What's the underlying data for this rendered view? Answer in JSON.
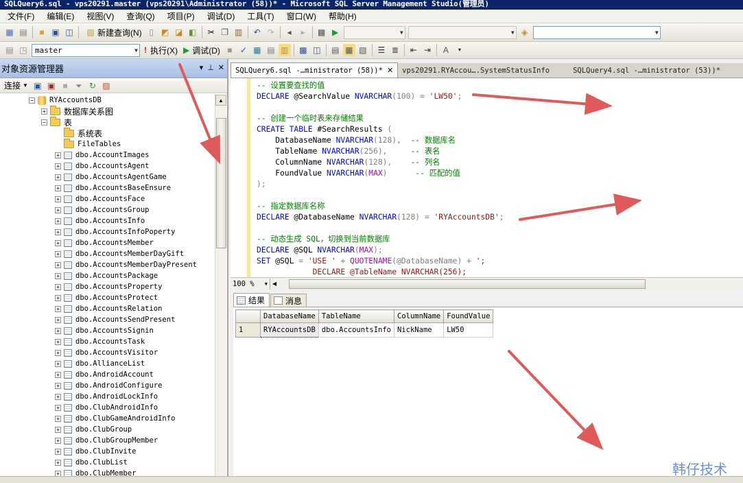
{
  "window": {
    "title": "SQLQuery6.sql - vps20291.master (vps20291\\Administrator (58))* - Microsoft SQL Server Management Studio(管理员)"
  },
  "menu": [
    "文件(F)",
    "编辑(E)",
    "视图(V)",
    "查询(Q)",
    "项目(P)",
    "调试(D)",
    "工具(T)",
    "窗口(W)",
    "帮助(H)"
  ],
  "toolbar": {
    "new_query": "新建查询(N)",
    "database": "master",
    "execute": "执行(X)",
    "debug": "调试(D)"
  },
  "object_explorer": {
    "title": "对象资源管理器",
    "connect": "连接",
    "tree": [
      {
        "label": "RYAccountsDB",
        "kind": "db",
        "expander": "−"
      },
      {
        "label": "数据库关系图",
        "kind": "folder",
        "expander": "+"
      },
      {
        "label": "表",
        "kind": "folder",
        "expander": "−"
      },
      {
        "label": "系统表",
        "kind": "folder",
        "expander": ""
      },
      {
        "label": "FileTables",
        "kind": "folder",
        "expander": ""
      },
      {
        "label": "dbo.AccountImages",
        "kind": "table",
        "expander": "+"
      },
      {
        "label": "dbo.AccountsAgent",
        "kind": "table",
        "expander": "+"
      },
      {
        "label": "dbo.AccountsAgentGame",
        "kind": "table",
        "expander": "+"
      },
      {
        "label": "dbo.AccountsBaseEnsure",
        "kind": "table",
        "expander": "+"
      },
      {
        "label": "dbo.AccountsFace",
        "kind": "table",
        "expander": "+"
      },
      {
        "label": "dbo.AccountsGroup",
        "kind": "table",
        "expander": "+"
      },
      {
        "label": "dbo.AccountsInfo",
        "kind": "table",
        "expander": "+"
      },
      {
        "label": "dbo.AccountsInfoPoperty",
        "kind": "table",
        "expander": "+"
      },
      {
        "label": "dbo.AccountsMember",
        "kind": "table",
        "expander": "+"
      },
      {
        "label": "dbo.AccountsMemberDayGift",
        "kind": "table",
        "expander": "+"
      },
      {
        "label": "dbo.AccountsMemberDayPresent",
        "kind": "table",
        "expander": "+"
      },
      {
        "label": "dbo.AccountsPackage",
        "kind": "table",
        "expander": "+"
      },
      {
        "label": "dbo.AccountsProperty",
        "kind": "table",
        "expander": "+"
      },
      {
        "label": "dbo.AccountsProtect",
        "kind": "table",
        "expander": "+"
      },
      {
        "label": "dbo.AccountsRelation",
        "kind": "table",
        "expander": "+"
      },
      {
        "label": "dbo.AccountsSendPresent",
        "kind": "table",
        "expander": "+"
      },
      {
        "label": "dbo.AccountsSignin",
        "kind": "table",
        "expander": "+"
      },
      {
        "label": "dbo.AccountsTask",
        "kind": "table",
        "expander": "+"
      },
      {
        "label": "dbo.AccountsVisitor",
        "kind": "table",
        "expander": "+"
      },
      {
        "label": "dbo.AllianceList",
        "kind": "table",
        "expander": "+"
      },
      {
        "label": "dbo.AndroidAccount",
        "kind": "table",
        "expander": "+"
      },
      {
        "label": "dbo.AndroidConfigure",
        "kind": "table",
        "expander": "+"
      },
      {
        "label": "dbo.AndroidLockInfo",
        "kind": "table",
        "expander": "+"
      },
      {
        "label": "dbo.ClubAndroidInfo",
        "kind": "table",
        "expander": "+"
      },
      {
        "label": "dbo.ClubGameAndroidInfo",
        "kind": "table",
        "expander": "+"
      },
      {
        "label": "dbo.ClubGroup",
        "kind": "table",
        "expander": "+"
      },
      {
        "label": "dbo.ClubGroupMember",
        "kind": "table",
        "expander": "+"
      },
      {
        "label": "dbo.ClubInvite",
        "kind": "table",
        "expander": "+"
      },
      {
        "label": "dbo.ClubList",
        "kind": "table",
        "expander": "+"
      },
      {
        "label": "dbo.ClubMember",
        "kind": "table",
        "expander": "+"
      }
    ]
  },
  "tabs": [
    {
      "label": "SQLQuery6.sql -…ministrator (58))*",
      "active": true
    },
    {
      "label": "vps20291.RYAccou….SystemStatusInfo",
      "active": false
    },
    {
      "label": "SQLQuery4.sql -…ministrator (53))*",
      "active": false
    }
  ],
  "editor": {
    "zoom": "100 %",
    "lines": [
      [
        {
          "t": "-- 设置要查找的值",
          "c": "comment"
        }
      ],
      [
        {
          "t": "DECLARE",
          "c": "kw"
        },
        {
          "t": " @SearchValue ",
          "c": ""
        },
        {
          "t": "NVARCHAR",
          "c": "kw"
        },
        {
          "t": "(100) ",
          "c": "gray"
        },
        {
          "t": "= ",
          "c": "gray"
        },
        {
          "t": "'LW50'",
          "c": "str"
        },
        {
          "t": ";",
          "c": "gray"
        }
      ],
      [
        {
          "t": "",
          "c": ""
        }
      ],
      [
        {
          "t": "-- 创建一个临时表来存储结果",
          "c": "comment"
        }
      ],
      [
        {
          "t": "CREATE TABLE",
          "c": "kw"
        },
        {
          "t": " #SearchResults ",
          "c": ""
        },
        {
          "t": "(",
          "c": "gray"
        }
      ],
      [
        {
          "t": "    DatabaseName ",
          "c": ""
        },
        {
          "t": "NVARCHAR",
          "c": "kw"
        },
        {
          "t": "(128),",
          "c": "gray"
        },
        {
          "t": "  -- 数据库名",
          "c": "comment"
        }
      ],
      [
        {
          "t": "    TableName ",
          "c": ""
        },
        {
          "t": "NVARCHAR",
          "c": "kw"
        },
        {
          "t": "(256),",
          "c": "gray"
        },
        {
          "t": "     -- 表名",
          "c": "comment"
        }
      ],
      [
        {
          "t": "    ColumnName ",
          "c": ""
        },
        {
          "t": "NVARCHAR",
          "c": "kw"
        },
        {
          "t": "(128),",
          "c": "gray"
        },
        {
          "t": "    -- 列名",
          "c": "comment"
        }
      ],
      [
        {
          "t": "    FoundValue ",
          "c": ""
        },
        {
          "t": "NVARCHAR",
          "c": "kw"
        },
        {
          "t": "(",
          "c": "gray"
        },
        {
          "t": "MAX",
          "c": "fn"
        },
        {
          "t": ")",
          "c": "gray"
        },
        {
          "t": "      -- 匹配的值",
          "c": "comment"
        }
      ],
      [
        {
          "t": ");",
          "c": "gray"
        }
      ],
      [
        {
          "t": "",
          "c": ""
        }
      ],
      [
        {
          "t": "-- 指定数据库名称",
          "c": "comment"
        }
      ],
      [
        {
          "t": "DECLARE",
          "c": "kw"
        },
        {
          "t": " @DatabaseName ",
          "c": ""
        },
        {
          "t": "NVARCHAR",
          "c": "kw"
        },
        {
          "t": "(128) ",
          "c": "gray"
        },
        {
          "t": "= ",
          "c": "gray"
        },
        {
          "t": "'RYAccountsDB'",
          "c": "str"
        },
        {
          "t": ";",
          "c": "gray"
        }
      ],
      [
        {
          "t": "",
          "c": ""
        }
      ],
      [
        {
          "t": "-- 动态生成 SQL，切换到当前数据库",
          "c": "comment"
        }
      ],
      [
        {
          "t": "DECLARE",
          "c": "kw"
        },
        {
          "t": " @SQL ",
          "c": ""
        },
        {
          "t": "NVARCHAR",
          "c": "kw"
        },
        {
          "t": "(",
          "c": "gray"
        },
        {
          "t": "MAX",
          "c": "fn"
        },
        {
          "t": ");",
          "c": "gray"
        }
      ],
      [
        {
          "t": "SET",
          "c": "kw"
        },
        {
          "t": " @SQL ",
          "c": ""
        },
        {
          "t": "= ",
          "c": "gray"
        },
        {
          "t": "'USE '",
          "c": "str"
        },
        {
          "t": " + ",
          "c": "gray"
        },
        {
          "t": "QUOTENAME",
          "c": "fn"
        },
        {
          "t": "(@DatabaseName) + ",
          "c": "gray"
        },
        {
          "t": "';",
          "c": "str"
        }
      ],
      [
        {
          "t": "            DECLARE @TableName NVARCHAR(256);",
          "c": "str"
        }
      ]
    ]
  },
  "results": {
    "tab_results": "结果",
    "tab_messages": "消息",
    "columns": [
      "DatabaseName",
      "TableName",
      "ColumnName",
      "FoundValue"
    ],
    "rows": [
      {
        "num": "1",
        "cells": [
          "RYAccountsDB",
          "dbo.AccountsInfo",
          "NickName",
          "LW50"
        ]
      }
    ]
  },
  "watermark": "韩仔技术",
  "colors": {
    "titlebar": "#0a246a",
    "keyword": "#0000ff",
    "comment": "#008000",
    "string": "#a31515",
    "function": "#c000c0",
    "annotation_arrow": "#e05a5a"
  }
}
